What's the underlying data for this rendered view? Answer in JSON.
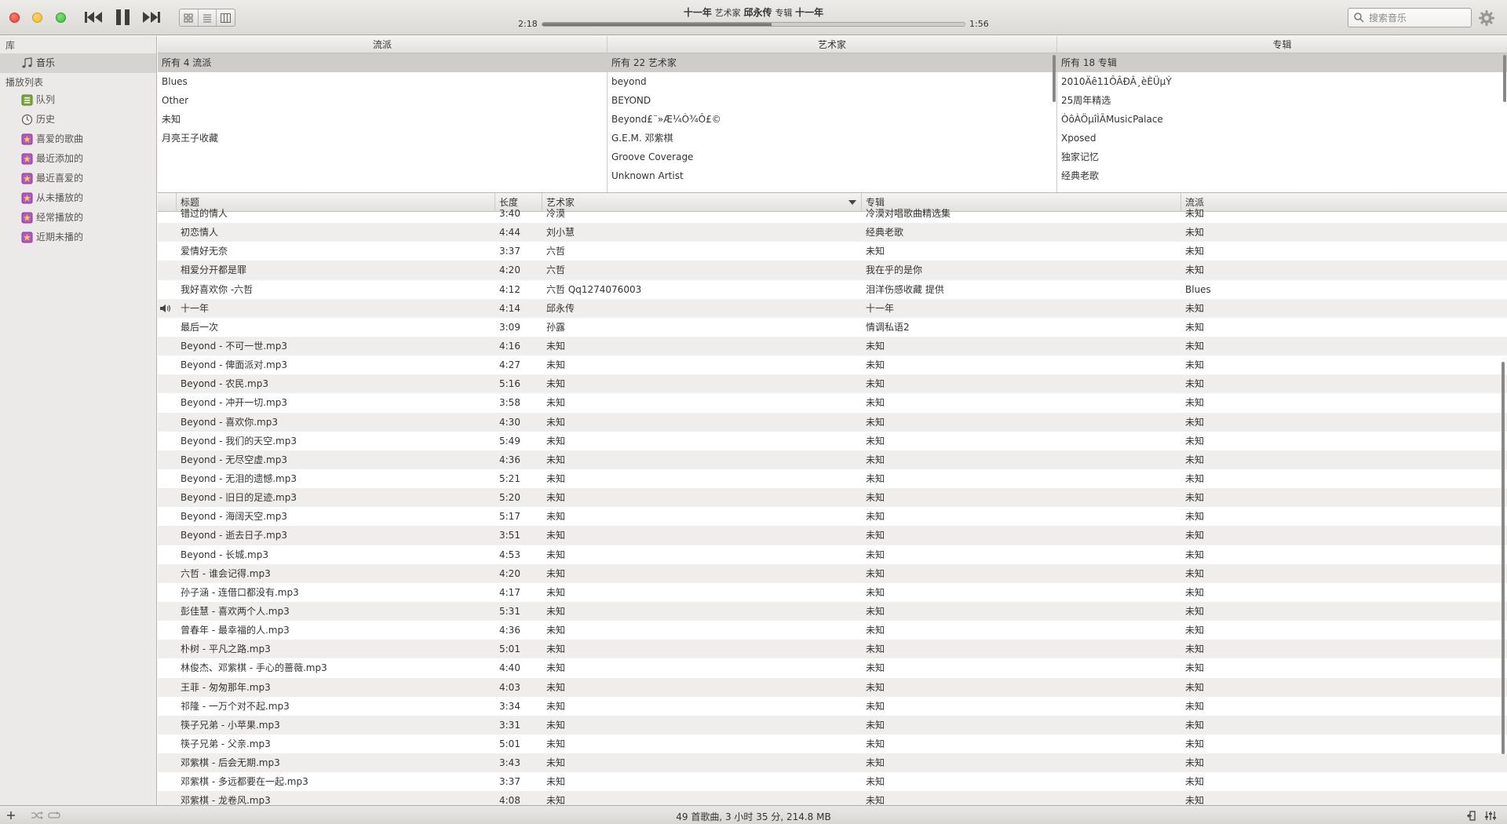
{
  "now_playing": {
    "track": "十一年",
    "artist_prefix": "艺术家",
    "artist": "邱永传",
    "album_prefix": "专辑",
    "album": "十一年",
    "elapsed": "2:18",
    "remaining": "1:56",
    "progress_fraction": 0.543
  },
  "search": {
    "placeholder": "搜索音乐"
  },
  "sidebar": {
    "library_label": "库",
    "music_label": "音乐",
    "playlists_label": "播放列表",
    "playlists": [
      {
        "label": "队列",
        "icon": "queue-icon"
      },
      {
        "label": "历史",
        "icon": "history-icon"
      },
      {
        "label": "喜爱的歌曲",
        "icon": "smart-playlist-icon"
      },
      {
        "label": "最近添加的",
        "icon": "smart-playlist-icon"
      },
      {
        "label": "最近喜爱的",
        "icon": "smart-playlist-icon"
      },
      {
        "label": "从未播放的",
        "icon": "smart-playlist-icon"
      },
      {
        "label": "经常播放的",
        "icon": "smart-playlist-icon"
      },
      {
        "label": "近期未播的",
        "icon": "smart-playlist-icon"
      }
    ]
  },
  "browser": {
    "genre": {
      "header": "流派",
      "items": [
        "所有 4 流派",
        "Blues",
        "Other",
        "未知",
        "月亮王子收藏"
      ]
    },
    "artist": {
      "header": "艺术家",
      "items": [
        "所有 22 艺术家",
        "beyond",
        "BEYOND",
        "Beyond£¨»Æ¼Ò¾Ô£©",
        "G.E.M. 邓紫棋",
        "Groove Coverage",
        "Unknown Artist"
      ]
    },
    "album": {
      "header": "专辑",
      "items": [
        "所有 18 专辑",
        "2010Äê11ÔÂÐÂ¸èÈÜµÝ",
        "25周年精选",
        "ÒôÀÖµîÌÃMusicPalace",
        "Xposed",
        "独家记忆",
        "经典老歌"
      ]
    }
  },
  "tracklist": {
    "columns": {
      "title": "标题",
      "length": "长度",
      "artist": "艺术家",
      "album": "专辑",
      "genre": "流派"
    },
    "rows": [
      {
        "title": "错过的情人",
        "length": "3:40",
        "artist": "冷漠",
        "album": "冷漠对唱歌曲精选集",
        "genre": "未知"
      },
      {
        "title": "初恋情人",
        "length": "4:44",
        "artist": "刘小慧",
        "album": "经典老歌",
        "genre": "未知"
      },
      {
        "title": "爱情好无奈",
        "length": "3:37",
        "artist": "六哲",
        "album": "未知",
        "genre": "未知"
      },
      {
        "title": "相爱分开都是罪",
        "length": "4:20",
        "artist": "六哲",
        "album": "我在乎的是你",
        "genre": "未知"
      },
      {
        "title": "我好喜欢你 -六哲",
        "length": "4:12",
        "artist": "六哲 Qq1274076003",
        "album": "泪洋伤感收藏  提供",
        "genre": "Blues"
      },
      {
        "title": "十一年",
        "length": "4:14",
        "artist": "邱永传",
        "album": "十一年",
        "genre": "未知",
        "playing": true
      },
      {
        "title": "最后一次",
        "length": "3:09",
        "artist": "孙露",
        "album": "情调私语2",
        "genre": "未知"
      },
      {
        "title": "Beyond - 不可一世.mp3",
        "length": "4:16",
        "artist": "未知",
        "album": "未知",
        "genre": "未知"
      },
      {
        "title": "Beyond - 俾面派对.mp3",
        "length": "4:27",
        "artist": "未知",
        "album": "未知",
        "genre": "未知"
      },
      {
        "title": "Beyond - 农民.mp3",
        "length": "5:16",
        "artist": "未知",
        "album": "未知",
        "genre": "未知"
      },
      {
        "title": "Beyond - 冲开一切.mp3",
        "length": "3:58",
        "artist": "未知",
        "album": "未知",
        "genre": "未知"
      },
      {
        "title": "Beyond - 喜欢你.mp3",
        "length": "4:30",
        "artist": "未知",
        "album": "未知",
        "genre": "未知"
      },
      {
        "title": "Beyond - 我们的天空.mp3",
        "length": "5:49",
        "artist": "未知",
        "album": "未知",
        "genre": "未知"
      },
      {
        "title": "Beyond - 无尽空虚.mp3",
        "length": "4:36",
        "artist": "未知",
        "album": "未知",
        "genre": "未知"
      },
      {
        "title": "Beyond - 无泪的遗憾.mp3",
        "length": "5:21",
        "artist": "未知",
        "album": "未知",
        "genre": "未知"
      },
      {
        "title": "Beyond - 旧日的足迹.mp3",
        "length": "5:20",
        "artist": "未知",
        "album": "未知",
        "genre": "未知"
      },
      {
        "title": "Beyond - 海阔天空.mp3",
        "length": "5:17",
        "artist": "未知",
        "album": "未知",
        "genre": "未知"
      },
      {
        "title": "Beyond - 逝去日子.mp3",
        "length": "3:51",
        "artist": "未知",
        "album": "未知",
        "genre": "未知"
      },
      {
        "title": "Beyond - 长城.mp3",
        "length": "4:53",
        "artist": "未知",
        "album": "未知",
        "genre": "未知"
      },
      {
        "title": "六哲 - 谁会记得.mp3",
        "length": "4:20",
        "artist": "未知",
        "album": "未知",
        "genre": "未知"
      },
      {
        "title": "孙子涵 - 连借口都没有.mp3",
        "length": "4:17",
        "artist": "未知",
        "album": "未知",
        "genre": "未知"
      },
      {
        "title": "彭佳慧 - 喜欢两个人.mp3",
        "length": "5:31",
        "artist": "未知",
        "album": "未知",
        "genre": "未知"
      },
      {
        "title": "曾春年 - 最幸福的人.mp3",
        "length": "4:36",
        "artist": "未知",
        "album": "未知",
        "genre": "未知"
      },
      {
        "title": "朴树 - 平凡之路.mp3",
        "length": "5:01",
        "artist": "未知",
        "album": "未知",
        "genre": "未知"
      },
      {
        "title": "林俊杰、邓紫棋 - 手心的蔷薇.mp3",
        "length": "4:40",
        "artist": "未知",
        "album": "未知",
        "genre": "未知"
      },
      {
        "title": "王菲 - 匆匆那年.mp3",
        "length": "4:03",
        "artist": "未知",
        "album": "未知",
        "genre": "未知"
      },
      {
        "title": "祁隆 - 一万个对不起.mp3",
        "length": "3:34",
        "artist": "未知",
        "album": "未知",
        "genre": "未知"
      },
      {
        "title": "筷子兄弟 - 小苹果.mp3",
        "length": "3:31",
        "artist": "未知",
        "album": "未知",
        "genre": "未知"
      },
      {
        "title": "筷子兄弟 - 父亲.mp3",
        "length": "5:01",
        "artist": "未知",
        "album": "未知",
        "genre": "未知"
      },
      {
        "title": "邓紫棋 - 后会无期.mp3",
        "length": "3:43",
        "artist": "未知",
        "album": "未知",
        "genre": "未知"
      },
      {
        "title": "邓紫棋 - 多远都要在一起.mp3",
        "length": "3:37",
        "artist": "未知",
        "album": "未知",
        "genre": "未知"
      },
      {
        "title": "邓紫棋 - 龙卷风.mp3",
        "length": "4:08",
        "artist": "未知",
        "album": "未知",
        "genre": "未知"
      }
    ]
  },
  "status": {
    "summary": "49 首歌曲, 3 小时 35 分, 214.8 MB"
  },
  "colors": {
    "close": "#e0443a",
    "minimize": "#f2b52b",
    "maximize": "#3cba3a",
    "selection": "#cfcdca",
    "alt_row": "#efeeed"
  }
}
